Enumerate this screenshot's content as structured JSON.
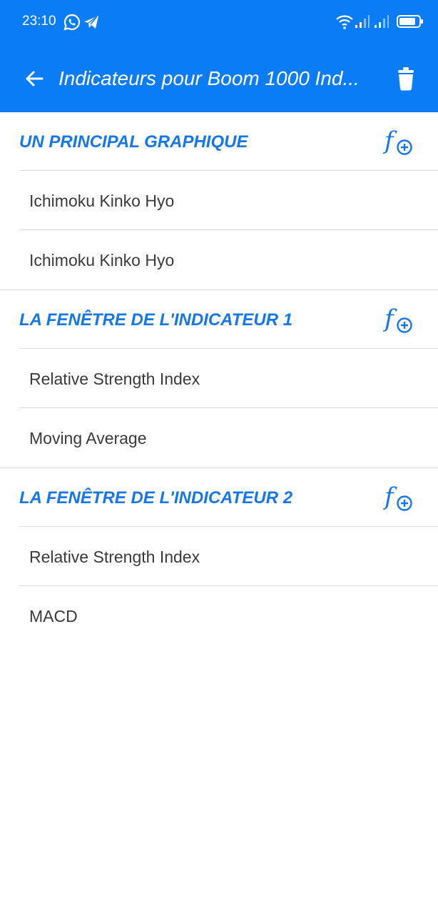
{
  "status_bar": {
    "time": "23:10",
    "icons": [
      "whatsapp-icon",
      "telegram-icon",
      "wifi-icon",
      "signal-icon",
      "signal-icon",
      "battery-icon"
    ]
  },
  "toolbar": {
    "title": "Indicateurs pour Boom 1000 Ind...",
    "back_icon": "arrow-left-icon",
    "delete_icon": "trash-icon",
    "color": "#0a7cf5"
  },
  "sections": [
    {
      "title": "UN PRINCIPAL GRAPHIQUE",
      "add_icon": "function-add-icon",
      "items": [
        "Ichimoku Kinko Hyo",
        "Ichimoku Kinko Hyo"
      ]
    },
    {
      "title": "LA FENÊTRE DE L'INDICATEUR 1",
      "add_icon": "function-add-icon",
      "items": [
        "Relative Strength Index",
        "Moving Average"
      ]
    },
    {
      "title": "LA FENÊTRE DE L'INDICATEUR 2",
      "add_icon": "function-add-icon",
      "items": [
        "Relative Strength Index",
        "MACD"
      ]
    }
  ],
  "accent_color": "#1677e8"
}
